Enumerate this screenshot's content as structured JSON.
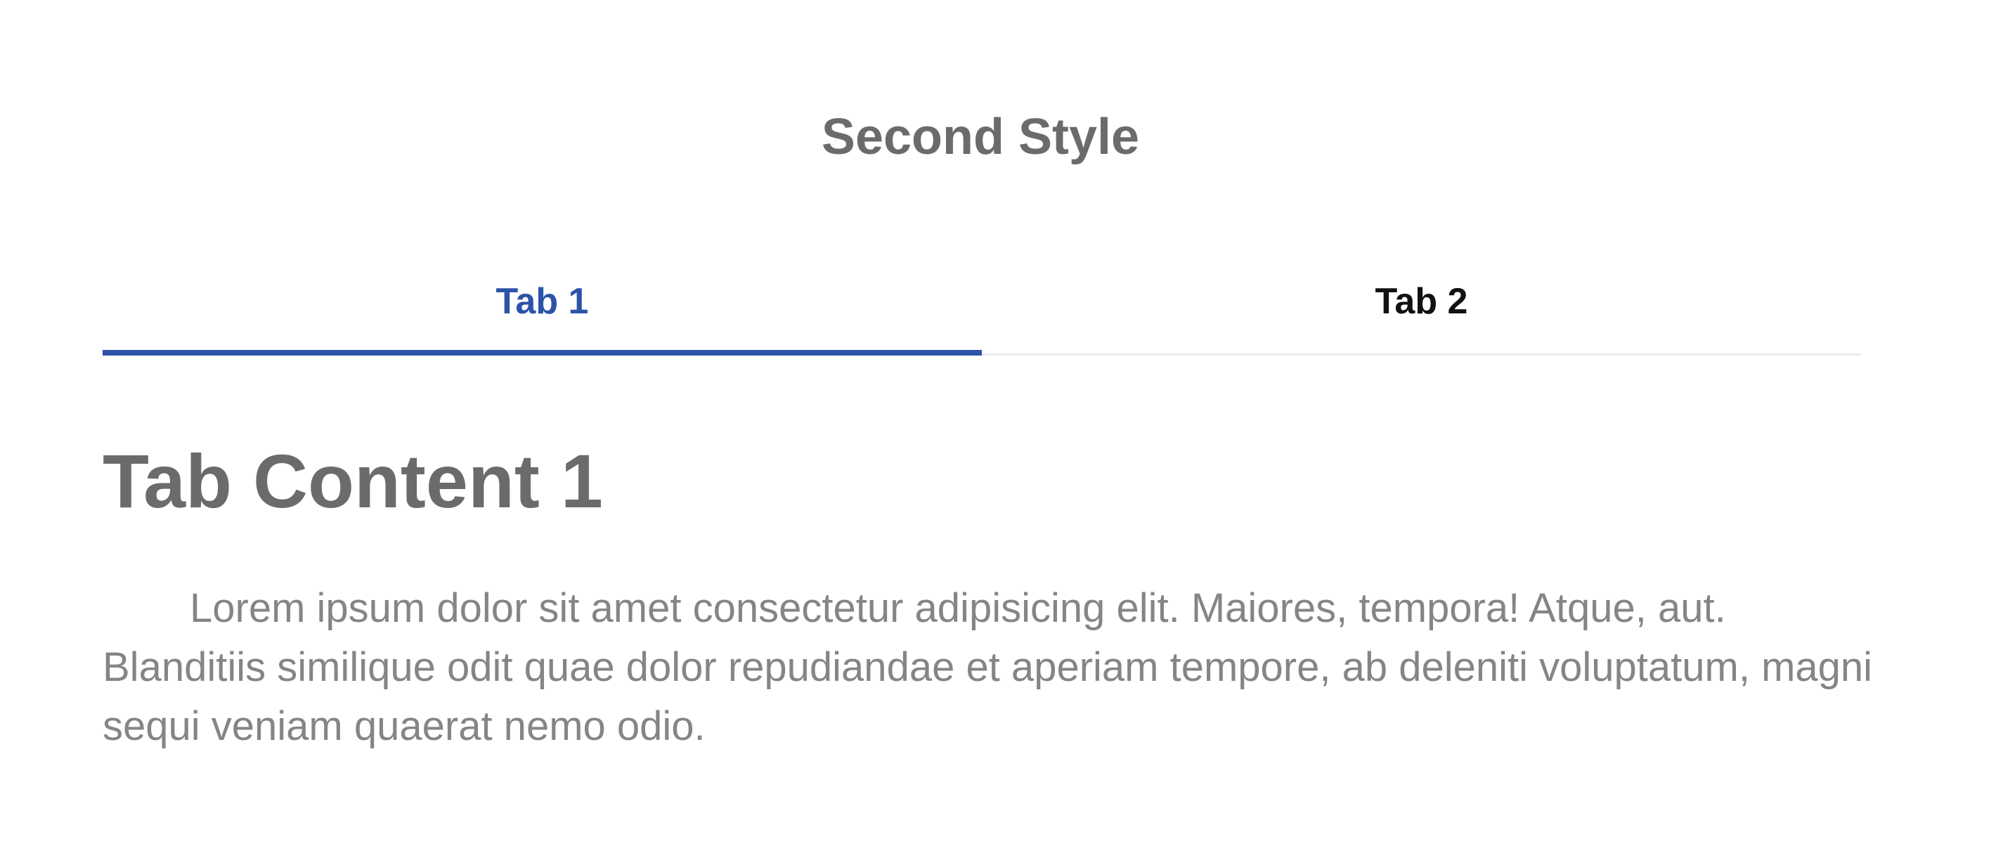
{
  "page": {
    "title": "Second Style"
  },
  "colors": {
    "accent": "#2b54a8",
    "heading_text": "#6b6b6b",
    "body_text": "#858585",
    "inactive_tab_text": "#111111",
    "tab_divider": "#ebebeb"
  },
  "tabs": [
    {
      "label": "Tab 1",
      "active": true
    },
    {
      "label": "Tab 2",
      "active": false
    }
  ],
  "content": {
    "title": "Tab Content 1",
    "body": "Lorem ipsum dolor sit amet consectetur adipisicing elit. Maiores, tempora! Atque, aut. Blanditiis similique odit quae dolor repudiandae et aperiam tempore, ab deleniti voluptatum, magni sequi veniam quaerat nemo odio."
  }
}
